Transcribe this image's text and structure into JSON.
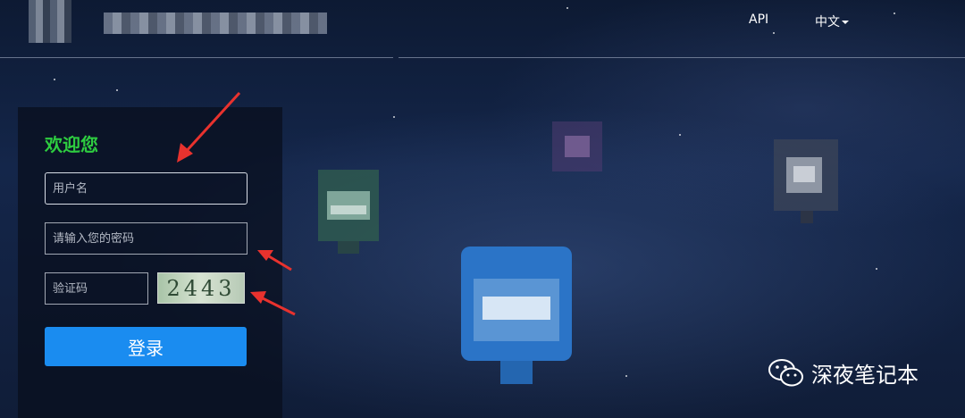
{
  "header": {
    "nav": {
      "api_label": "API",
      "lang_label": "中文"
    }
  },
  "login": {
    "welcome": "欢迎您",
    "username_placeholder": "用户名",
    "password_placeholder": "请输入您的密码",
    "captcha_placeholder": "验证码",
    "captcha_code": "2443",
    "submit_label": "登录"
  },
  "watermark": {
    "text": "深夜笔记本",
    "icon": "wechat-icon"
  },
  "colors": {
    "welcome": "#2ecc40",
    "button": "#1a8cf0",
    "annotation_arrow": "#e8322e"
  }
}
